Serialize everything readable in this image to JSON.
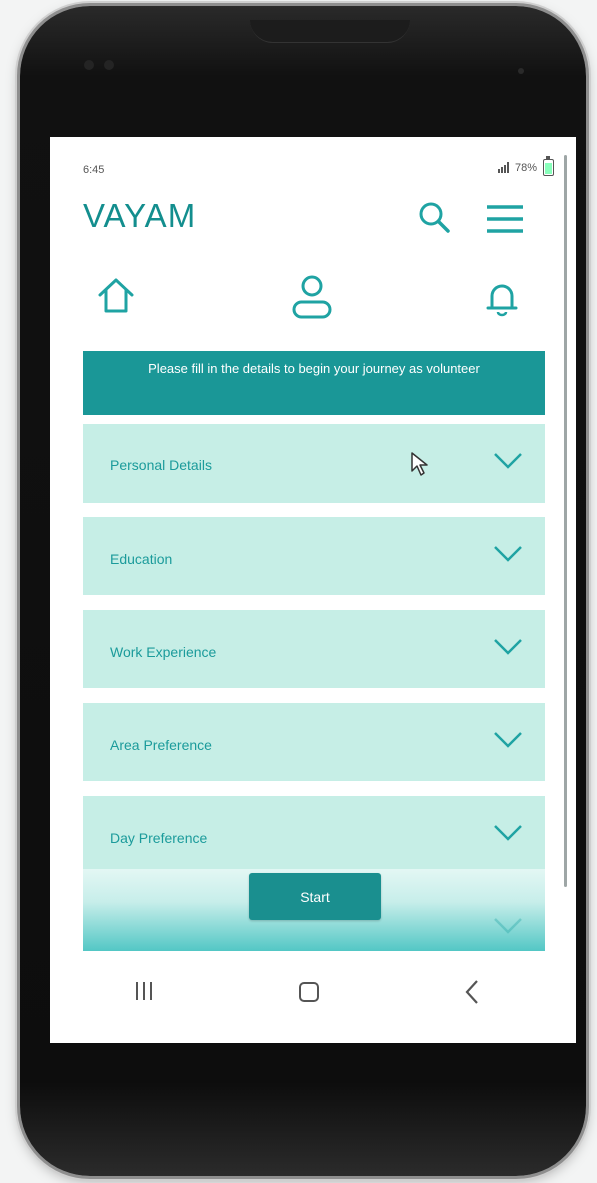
{
  "status": {
    "time": "6:45",
    "battery": "78%"
  },
  "app": {
    "brand": "VAYAM"
  },
  "banner": {
    "text": "Please fill in the details to begin your journey as volunteer"
  },
  "sections": [
    {
      "label": "Personal Details"
    },
    {
      "label": "Education"
    },
    {
      "label": "Work Experience"
    },
    {
      "label": "Area Preference"
    },
    {
      "label": "Day Preference"
    }
  ],
  "start_button": {
    "label": "Start"
  },
  "colors": {
    "accent": "#1a9797",
    "section_bg": "#c6eee6",
    "label": "#1b9b9b"
  }
}
